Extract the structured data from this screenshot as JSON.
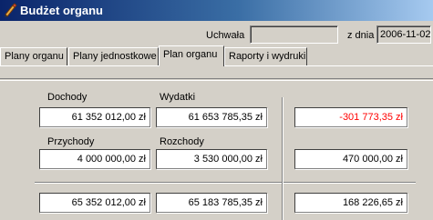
{
  "window": {
    "title": "Budżet organu",
    "icon": "pencil-icon"
  },
  "filters": {
    "uchwala_label": "Uchwała",
    "uchwala_value": "",
    "z_dnia_label": "z dnia",
    "date_value": "2006-11-02"
  },
  "tabs": [
    {
      "label": "Plany organu",
      "active": false
    },
    {
      "label": "Plany jednostkowe",
      "active": false
    },
    {
      "label": "Plan organu",
      "active": true
    },
    {
      "label": "Raporty i wydruki",
      "active": false
    }
  ],
  "plan": {
    "dochody_label": "Dochody",
    "wydatki_label": "Wydatki",
    "przychody_label": "Przychody",
    "rozchody_label": "Rozchody",
    "dochody_value": "61 352 012,00 zł",
    "wydatki_value": "61 653 785,35 zł",
    "deficit_value": "-301 773,35 zł",
    "przychody_value": "4 000 000,00 zł",
    "rozchody_value": "3 530 000,00 zł",
    "finance_diff_value": "470 000,00 zł",
    "total_income_value": "65 352 012,00 zł",
    "total_expense_value": "65 183 785,35 zł",
    "balance_value": "168 226,65 zł"
  },
  "colors": {
    "negative": "#ff0000",
    "titlebar_start": "#0a246a",
    "titlebar_end": "#a6caf0",
    "face": "#d4d0c8"
  }
}
